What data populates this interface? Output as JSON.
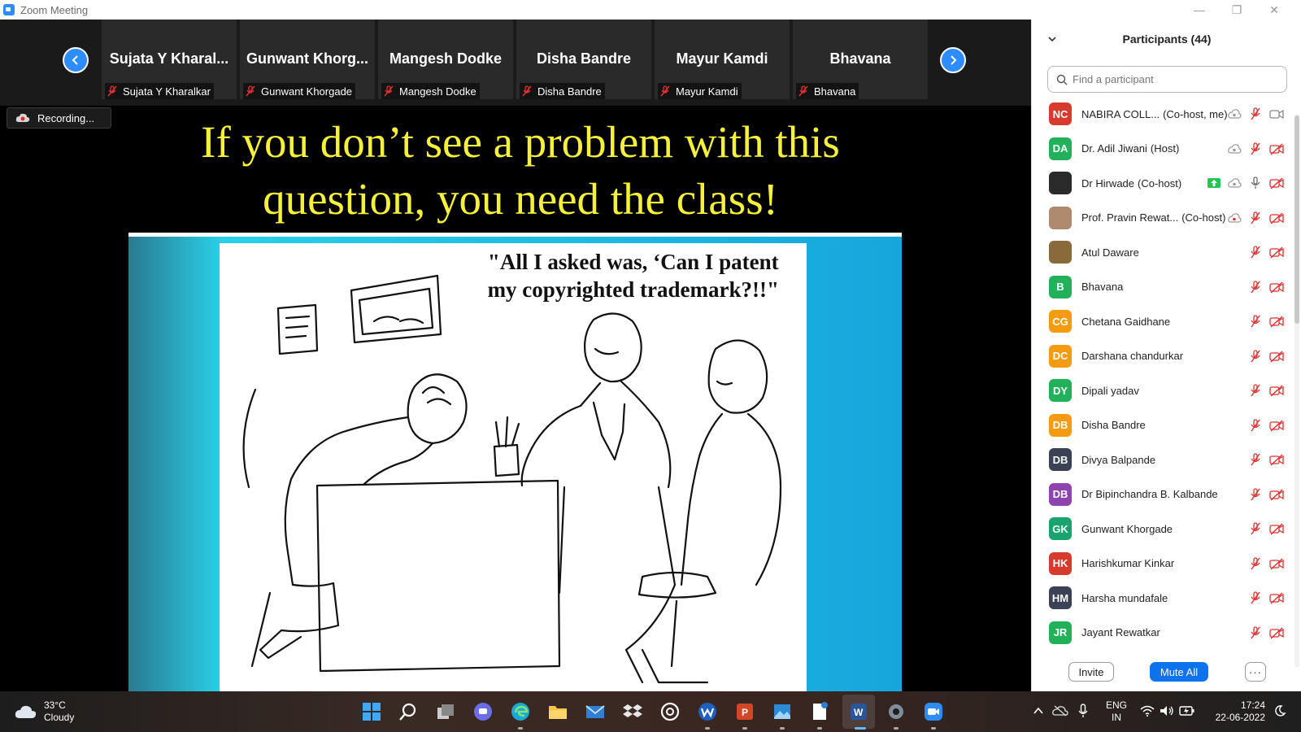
{
  "window": {
    "title": "Zoom Meeting"
  },
  "gallery": {
    "tiles": [
      {
        "display": "Sujata Y Kharal...",
        "label": "Sujata Y Kharalkar"
      },
      {
        "display": "Gunwant Khorg...",
        "label": "Gunwant Khorgade"
      },
      {
        "display": "Mangesh Dodke",
        "label": "Mangesh Dodke"
      },
      {
        "display": "Disha Bandre",
        "label": "Disha Bandre"
      },
      {
        "display": "Mayur Kamdi",
        "label": "Mayur Kamdi"
      },
      {
        "display": "Bhavana",
        "label": "Bhavana"
      }
    ]
  },
  "recording": {
    "label": "Recording..."
  },
  "slide": {
    "title_line1": "If you don’t see a problem with this",
    "title_line2": "question, you need the class!",
    "caption_line1": "\"All I asked was, ‘Can I patent",
    "caption_line2": "my copyrighted trademark?!!\""
  },
  "participants_panel": {
    "title": "Participants (44)",
    "search_placeholder": "Find a participant",
    "invite_label": "Invite",
    "mute_all_label": "Mute All",
    "more_label": "···",
    "participants": [
      {
        "initials": "NC",
        "name": "NABIRA COLL...",
        "role": "(Co-host, me)",
        "color": "#d63b2e"
      },
      {
        "initials": "DA",
        "name": "Dr. Adil Jiwani",
        "role": "(Host)",
        "color": "#23b05a"
      },
      {
        "initials": "",
        "name": "Dr Hirwade",
        "role": "(Co-host)",
        "color": "#2b2b2b"
      },
      {
        "initials": "",
        "name": "Prof. Pravin Rewat...",
        "role": "(Co-host)",
        "color": "#b08a6e"
      },
      {
        "initials": "",
        "name": "Atul Daware",
        "role": "",
        "color": "#8a6a3a"
      },
      {
        "initials": "B",
        "name": "Bhavana",
        "role": "",
        "color": "#23b05a"
      },
      {
        "initials": "CG",
        "name": "Chetana  Gaidhane",
        "role": "",
        "color": "#f39c12"
      },
      {
        "initials": "DC",
        "name": "Darshana chandurkar",
        "role": "",
        "color": "#f39c12"
      },
      {
        "initials": "DY",
        "name": "Dipali yadav",
        "role": "",
        "color": "#23b05a"
      },
      {
        "initials": "DB",
        "name": "Disha Bandre",
        "role": "",
        "color": "#f39c12"
      },
      {
        "initials": "DB",
        "name": "Divya Balpande",
        "role": "",
        "color": "#3b4256"
      },
      {
        "initials": "DB",
        "name": "Dr Bipinchandra B. Kalbande",
        "role": "",
        "color": "#8e44ad"
      },
      {
        "initials": "GK",
        "name": "Gunwant Khorgade",
        "role": "",
        "color": "#1aa36e"
      },
      {
        "initials": "HK",
        "name": "Harishkumar Kinkar",
        "role": "",
        "color": "#d63b2e"
      },
      {
        "initials": "HM",
        "name": "Harsha mundafale",
        "role": "",
        "color": "#3b4256"
      },
      {
        "initials": "JR",
        "name": "Jayant Rewatkar",
        "role": "",
        "color": "#23b05a"
      }
    ]
  },
  "taskbar": {
    "temperature": "33°C",
    "weather": "Cloudy",
    "lang_line1": "ENG",
    "lang_line2": "IN",
    "time": "17:24",
    "date": "22-06-2022"
  }
}
